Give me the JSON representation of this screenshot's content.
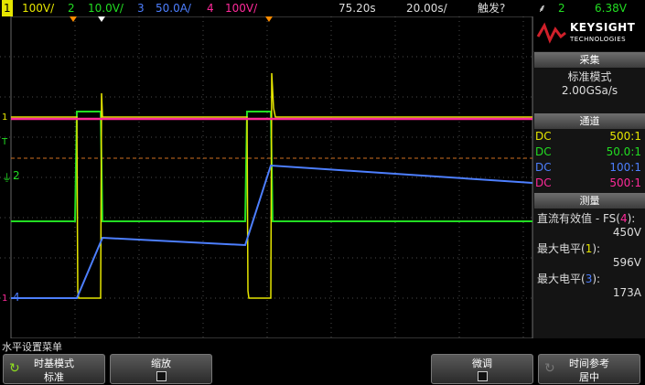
{
  "channels": {
    "ch1": {
      "num": "1",
      "scale": "100V/",
      "color": "#e6e600"
    },
    "ch2": {
      "num": "2",
      "scale": "10.0V/",
      "color": "#22dd22"
    },
    "ch3": {
      "num": "3",
      "scale": "50.0A/",
      "color": "#4d7fff"
    },
    "ch4": {
      "num": "4",
      "scale": "100V/",
      "color": "#ff2a9a"
    }
  },
  "timebase": {
    "delay": "75.20s",
    "scale": "20.00s/"
  },
  "trigger": {
    "label": "触发?",
    "source": "2",
    "level": "6.38V"
  },
  "brand": {
    "name": "KEYSIGHT",
    "sub": "TECHNOLOGIES"
  },
  "acquisition": {
    "header": "采集",
    "mode": "标准模式",
    "rate": "2.00GSa/s"
  },
  "channel_panel": {
    "header": "通道",
    "rows": [
      {
        "coupling": "DC",
        "ratio": "500:1",
        "color": "#e6e600"
      },
      {
        "coupling": "DC",
        "ratio": "50.0:1",
        "color": "#22dd22"
      },
      {
        "coupling": "DC",
        "ratio": "100:1",
        "color": "#4d7fff"
      },
      {
        "coupling": "DC",
        "ratio": "500:1",
        "color": "#ff2a9a"
      }
    ]
  },
  "measure": {
    "header": "测量",
    "items": [
      {
        "name": "直流有效值 - FS",
        "channel": "4",
        "value": "450V"
      },
      {
        "name": "最大电平",
        "channel": "1",
        "value": "596V"
      },
      {
        "name": "最大电平",
        "channel": "3",
        "value": "173A"
      }
    ]
  },
  "menu": {
    "title": "水平设置菜单",
    "timebase_mode_label": "时基模式",
    "timebase_mode_value": "标准",
    "zoom_label": "缩放",
    "fine_label": "微调",
    "time_ref_label": "时间参考",
    "time_ref_value": "居中"
  },
  "markers": {
    "ch1": "1",
    "ch2": "2",
    "ch4": "4",
    "trig": "T"
  }
}
